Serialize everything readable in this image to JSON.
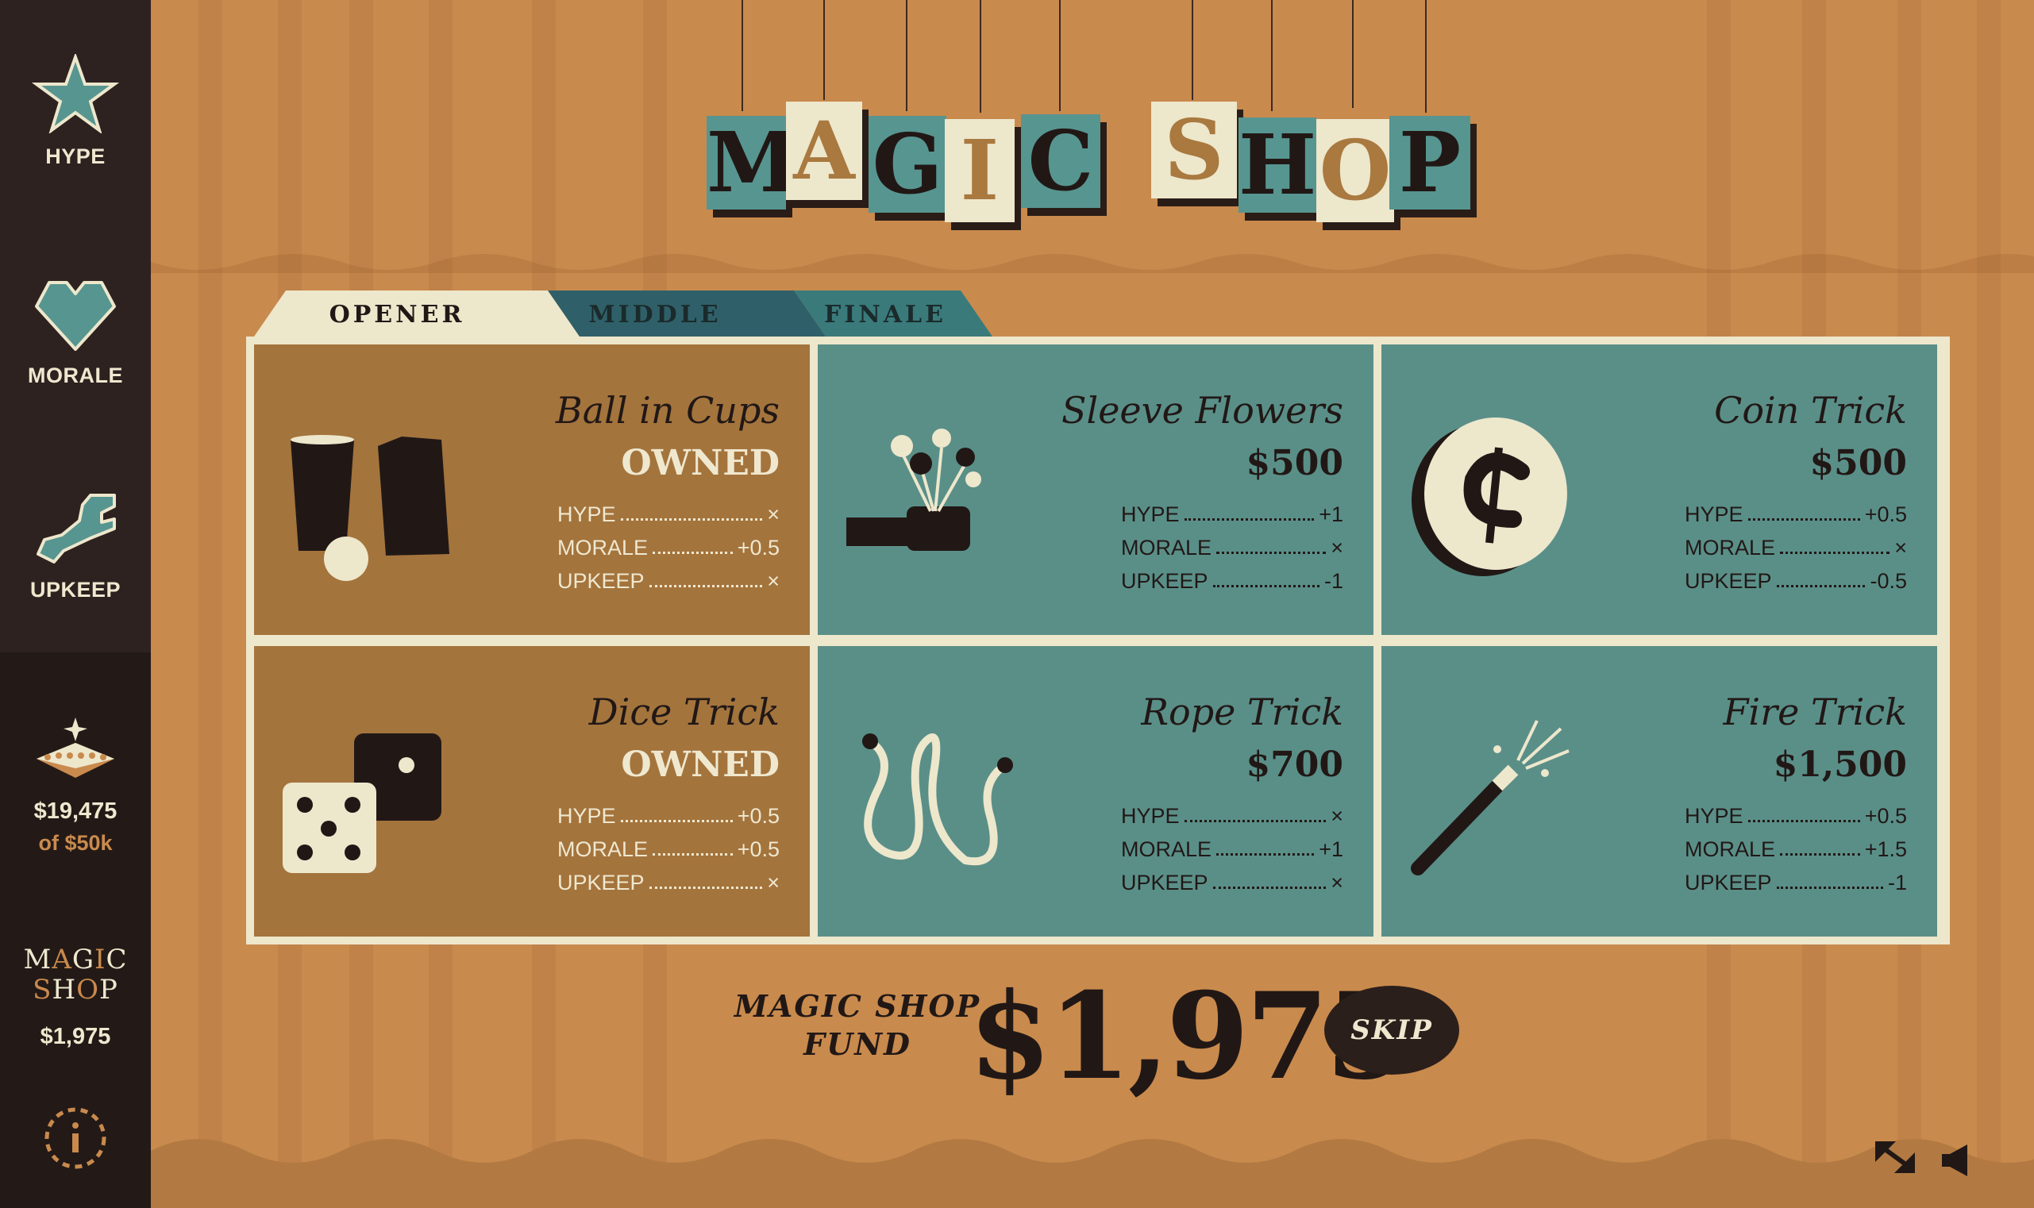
{
  "sidebar": {
    "stats": [
      {
        "label": "HYPE",
        "icon": "star-icon"
      },
      {
        "label": "MORALE",
        "icon": "heart-icon"
      },
      {
        "label": "UPKEEP",
        "icon": "wrench-icon"
      }
    ],
    "goal_amount": "$19,475",
    "goal_target": "of $50k",
    "shop_logo": {
      "line1": [
        "M",
        "A",
        "G",
        "I",
        "C"
      ],
      "line2": [
        "S",
        "H",
        "O",
        "P"
      ]
    },
    "shop_amount": "$1,975",
    "info_icon": "info-icon"
  },
  "title": {
    "word1": [
      "M",
      "A",
      "G",
      "I",
      "C"
    ],
    "word2": [
      "S",
      "H",
      "O",
      "P"
    ]
  },
  "tabs": [
    {
      "label": "OPENER",
      "active": true
    },
    {
      "label": "MIDDLE",
      "active": false
    },
    {
      "label": "FINALE",
      "active": false
    }
  ],
  "items": [
    {
      "name": "Ball in Cups",
      "price": "OWNED",
      "owned": true,
      "icon": "cups-icon",
      "stats": [
        {
          "k": "HYPE",
          "v": "×"
        },
        {
          "k": "MORALE",
          "v": "+0.5"
        },
        {
          "k": "UPKEEP",
          "v": "×"
        }
      ]
    },
    {
      "name": "Sleeve Flowers",
      "price": "$500",
      "owned": false,
      "icon": "flowers-icon",
      "stats": [
        {
          "k": "HYPE",
          "v": "+1"
        },
        {
          "k": "MORALE",
          "v": "×"
        },
        {
          "k": "UPKEEP",
          "v": "-1"
        }
      ]
    },
    {
      "name": "Coin Trick",
      "price": "$500",
      "owned": false,
      "icon": "coin-icon",
      "stats": [
        {
          "k": "HYPE",
          "v": "+0.5"
        },
        {
          "k": "MORALE",
          "v": "×"
        },
        {
          "k": "UPKEEP",
          "v": "-0.5"
        }
      ]
    },
    {
      "name": "Dice Trick",
      "price": "OWNED",
      "owned": true,
      "icon": "dice-icon",
      "stats": [
        {
          "k": "HYPE",
          "v": "+0.5"
        },
        {
          "k": "MORALE",
          "v": "+0.5"
        },
        {
          "k": "UPKEEP",
          "v": "×"
        }
      ]
    },
    {
      "name": "Rope Trick",
      "price": "$700",
      "owned": false,
      "icon": "rope-icon",
      "stats": [
        {
          "k": "HYPE",
          "v": "×"
        },
        {
          "k": "MORALE",
          "v": "+1"
        },
        {
          "k": "UPKEEP",
          "v": "×"
        }
      ]
    },
    {
      "name": "Fire Trick",
      "price": "$1,500",
      "owned": false,
      "icon": "wand-icon",
      "stats": [
        {
          "k": "HYPE",
          "v": "+0.5"
        },
        {
          "k": "MORALE",
          "v": "+1.5"
        },
        {
          "k": "UPKEEP",
          "v": "-1"
        }
      ]
    }
  ],
  "fund": {
    "label_line1": "MAGIC SHOP",
    "label_line2": "FUND",
    "amount": "$1,975"
  },
  "skip_label": "SKIP",
  "colors": {
    "teal": "#579590",
    "cream": "#ede7cc",
    "brown": "#a4743d",
    "dark": "#211816",
    "stage": "#c98a4d"
  }
}
